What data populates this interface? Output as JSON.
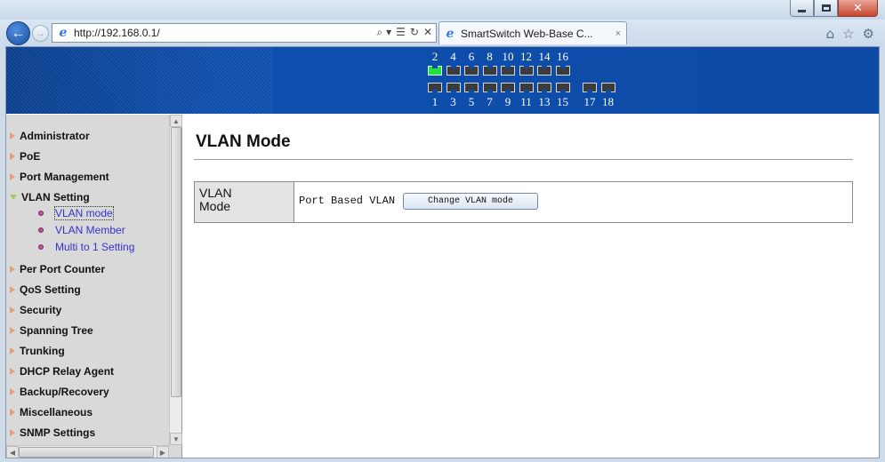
{
  "window": {
    "minimize_icon": "minimize-icon",
    "maximize_icon": "maximize-icon",
    "close_icon": "close-icon"
  },
  "browser": {
    "address": "http://192.168.0.1/",
    "address_tools": [
      "⌕ ▾",
      "☰",
      "↻",
      "✕"
    ],
    "tab_title": "SmartSwitch Web-Base C...",
    "tab_close": "×",
    "toolbar_icons": [
      "home-icon",
      "favorites-star-icon",
      "settings-gear-icon"
    ]
  },
  "banner": {
    "top_port_labels": [
      "2",
      "4",
      "6",
      "8",
      "10",
      "12",
      "14",
      "16"
    ],
    "bottom_port_labels": [
      "1",
      "3",
      "5",
      "7",
      "9",
      "11",
      "13",
      "15",
      "17",
      "18"
    ],
    "active_ports": [
      "2"
    ],
    "port_active_color": "#23e03a",
    "banner_color": "#0d4aa5"
  },
  "sidebar": {
    "items": [
      {
        "label": "Administrator",
        "expanded": false
      },
      {
        "label": "PoE",
        "expanded": false
      },
      {
        "label": "Port Management",
        "expanded": false
      },
      {
        "label": "VLAN Setting",
        "expanded": true,
        "children": [
          {
            "label": "VLAN mode",
            "active": true
          },
          {
            "label": "VLAN Member",
            "active": false
          },
          {
            "label": "Multi to 1 Setting",
            "active": false
          }
        ]
      },
      {
        "label": "Per Port Counter",
        "expanded": false
      },
      {
        "label": "QoS Setting",
        "expanded": false
      },
      {
        "label": "Security",
        "expanded": false
      },
      {
        "label": "Spanning Tree",
        "expanded": false
      },
      {
        "label": "Trunking",
        "expanded": false
      },
      {
        "label": "DHCP Relay Agent",
        "expanded": false
      },
      {
        "label": "Backup/Recovery",
        "expanded": false
      },
      {
        "label": "Miscellaneous",
        "expanded": false
      },
      {
        "label": "SNMP Settings",
        "expanded": false
      }
    ],
    "link_color": "#3333cc"
  },
  "main": {
    "title": "VLAN Mode",
    "table": {
      "label_line1": "VLAN",
      "label_line2": "Mode",
      "current_mode": "Port Based VLAN",
      "button_label": "Change VLAN mode"
    }
  }
}
